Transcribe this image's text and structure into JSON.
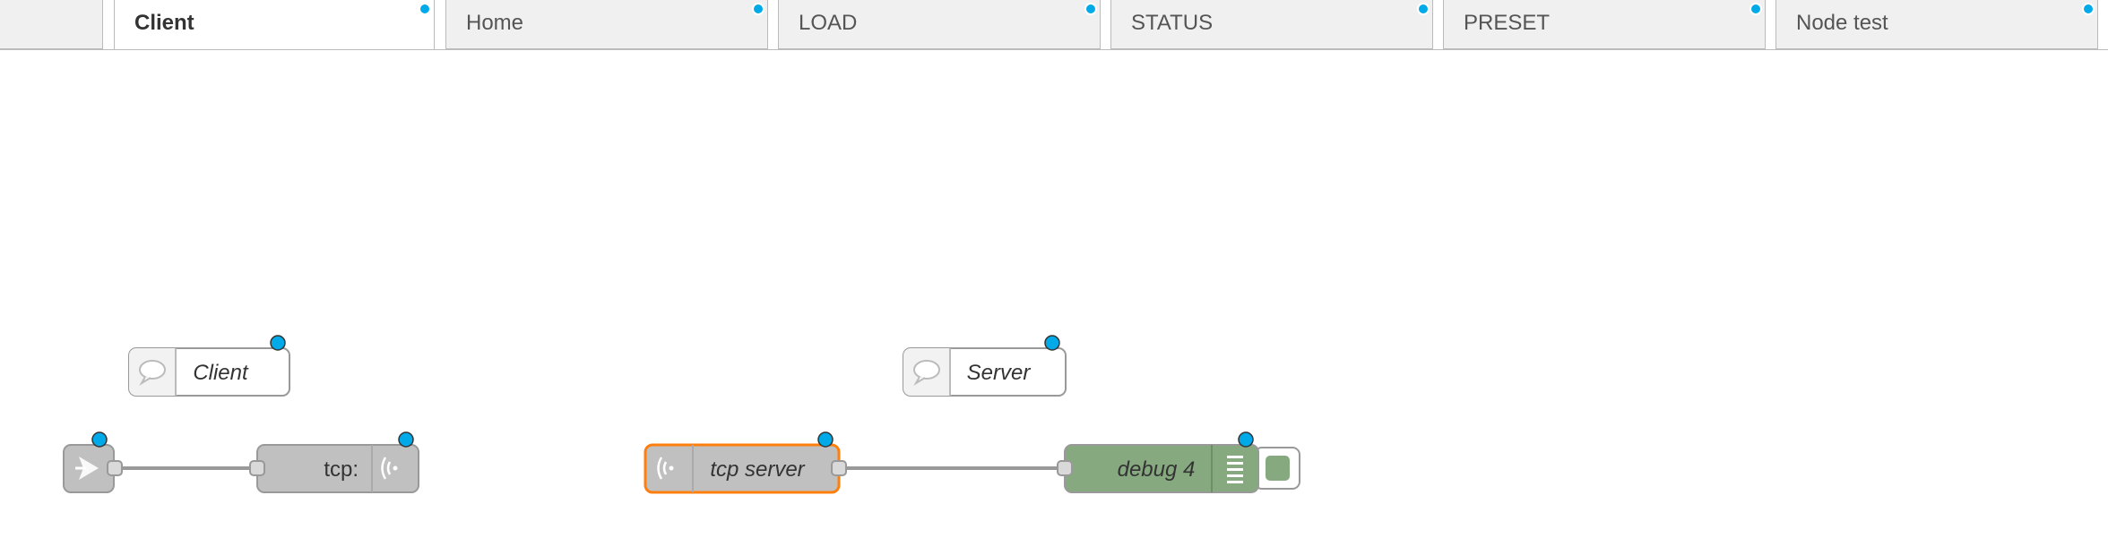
{
  "tabs": [
    {
      "label": ""
    },
    {
      "label": "Client",
      "active": true
    },
    {
      "label": "Home"
    },
    {
      "label": "LOAD"
    },
    {
      "label": "STATUS"
    },
    {
      "label": "PRESET"
    },
    {
      "label": "Node test"
    }
  ],
  "nodes": {
    "comment_client": "Client",
    "comment_server": "Server",
    "inject": "",
    "tcp_out": "tcp:",
    "tcp_server": "tcp server",
    "debug": "debug 4"
  },
  "colors": {
    "changed_dot": "#00a9e8",
    "selected_border": "#ff7f0e",
    "node_grey": "#c0c0c0",
    "debug_green": "#87a980",
    "wire": "#999999"
  },
  "icons": {
    "comment": "speech-bubble-icon",
    "inject": "inject-arrow-icon",
    "tcp": "wireless-signal-icon",
    "debug": "list-lines-icon"
  }
}
